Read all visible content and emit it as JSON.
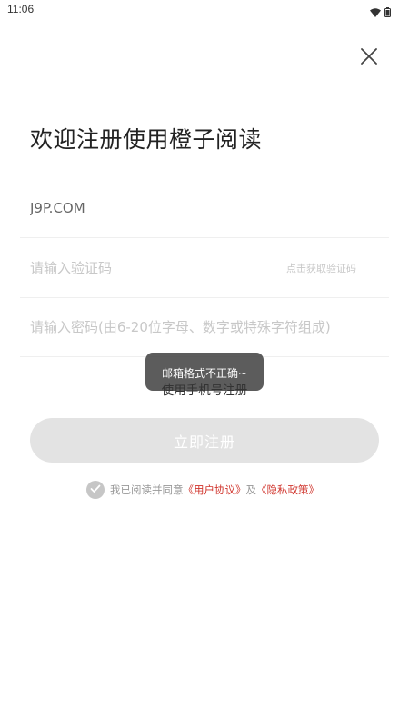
{
  "status_bar": {
    "time": "11:06"
  },
  "title": "欢迎注册使用橙子阅读",
  "form": {
    "email_value": "J9P.COM",
    "code_placeholder": "请输入验证码",
    "get_code_label": "点击获取验证码",
    "password_placeholder": "请输入密码(由6-20位字母、数字或特殊字符组成)"
  },
  "toast": {
    "message": "邮箱格式不正确~"
  },
  "switch_link": "使用手机号注册",
  "register_button": "立即注册",
  "agreement": {
    "prefix": "我已阅读并同意",
    "user_agreement": "《用户协议》",
    "conjunction": "及",
    "privacy_policy": "《隐私政策》"
  },
  "colors": {
    "link": "#d0342c",
    "button_disabled": "#e3e3e3",
    "checkbox": "#c6c6c6"
  },
  "icons": [
    "wifi-icon",
    "battery-icon",
    "close-icon",
    "checkmark-icon"
  ]
}
